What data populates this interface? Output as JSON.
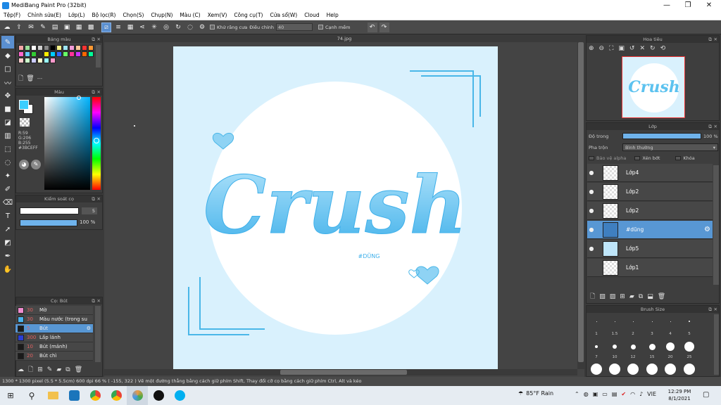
{
  "window": {
    "title": "MediBang Paint Pro (32bit)",
    "minimize": "—",
    "maximize": "❐",
    "close": "✕"
  },
  "menu": [
    "Tệp(F)",
    "Chỉnh sửa(E)",
    "Lớp(L)",
    "Bộ lọc(R)",
    "Chọn(S)",
    "Chụp(N)",
    "Màu (C)",
    "Xem(V)",
    "Công cụ(T)",
    "Cửa sổ(W)",
    "Cloud",
    "Help"
  ],
  "toolbar": {
    "antialias_label": "Khử răng cưa",
    "adjust_label": "Điều chỉnh",
    "adjust_value": "40",
    "smooth_label": "Cạnh mềm"
  },
  "tabs": {
    "file": "74.jpg"
  },
  "panels": {
    "palette_title": "Bảng màu",
    "palette_name": "---",
    "color_title": "Màu",
    "color_readout": {
      "r": "R:59",
      "g": "G:206",
      "b": "B:255",
      "hex": "#3BCEFF"
    },
    "brush_control_title": "Kiểm soát cọ",
    "brush_size_value": "5",
    "brush_opacity_value": "100 %",
    "brush_list_title": "Cọ: Bút",
    "navigator_title": "Hoa tiêu",
    "layer_title": "Lớp",
    "opacity_label": "Độ trong",
    "opacity_value": "100 %",
    "blend_label": "Pha trộn",
    "blend_value": "Bình thường",
    "protect_alpha": "Bảo vệ alpha",
    "clipping": "Xén bớt",
    "lock": "Khóa",
    "brush_size_title": "Brush Size"
  },
  "brushes": [
    {
      "size": "30",
      "name": "Mờ",
      "color": "#f08ccf"
    },
    {
      "size": "30",
      "name": "Màu nước (trong su",
      "color": "#4ab4f0"
    },
    {
      "size": "5",
      "name": "Bút",
      "color": "#1a1a1a"
    },
    {
      "size": "300",
      "name": "Lấp lánh",
      "color": "#2a3fd6"
    },
    {
      "size": "10",
      "name": "Bút (mảnh)",
      "color": "#1a1a1a"
    },
    {
      "size": "20",
      "name": "Bút chì",
      "color": "#1a1a1a"
    }
  ],
  "layers": [
    {
      "name": "Lớp4",
      "selected": false
    },
    {
      "name": "Lớp2",
      "selected": false
    },
    {
      "name": "Lớp2",
      "selected": false
    },
    {
      "name": "#dũng",
      "selected": true
    },
    {
      "name": "Lớp5",
      "selected": false
    },
    {
      "name": "Lớp1",
      "selected": false
    }
  ],
  "brush_sizes": {
    "row1": [
      "1",
      "1.5",
      "2",
      "3",
      "4",
      "5"
    ],
    "row2": [
      "7",
      "10",
      "12",
      "15",
      "20",
      "25"
    ]
  },
  "artwork": {
    "text": "Crush",
    "signature": "#DŨNG",
    "bg": "#d9f1fd",
    "accent": "#4ab7e8"
  },
  "status": "1300 * 1300 pixel   (5.5 * 5.5cm)   600 dpi   66 %   ( -155, 322 )   Vẽ một đường thẳng bằng cách giữ phím Shift, Thay đổi cỡ cọ bằng cách giữ phím Ctrl, Alt và kéo",
  "taskbar": {
    "weather": "85°F  Rain",
    "lang": "VIE",
    "time": "12:29 PM",
    "date": "8/1/2021"
  },
  "colors": {
    "accent": "#5897d4",
    "current_color": "#3bceff"
  }
}
